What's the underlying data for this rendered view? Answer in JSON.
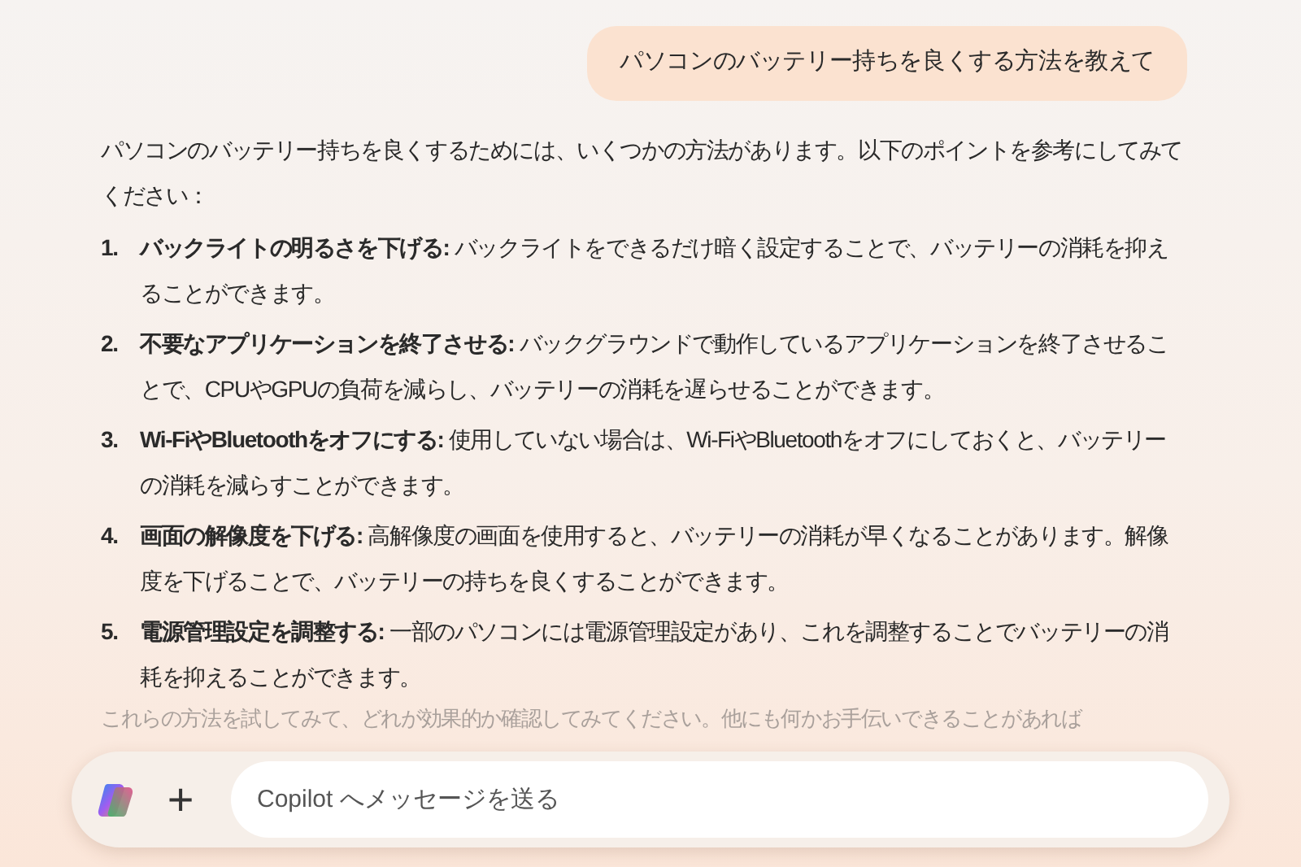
{
  "user_message": "パソコンのバッテリー持ちを良くする方法を教えて",
  "reply": {
    "intro": "パソコンのバッテリー持ちを良くするためには、いくつかの方法があります。以下のポイントを参考にしてみてください：",
    "items": [
      {
        "number": "1.",
        "text": "**バックライトの明るさを下げる:** バックライトをできるだけ暗く設定することで、バッテリーの消耗を抑えることができます。"
      },
      {
        "number": "2.",
        "text": "**不要なアプリケーションを終了させる:** バックグラウンドで動作しているアプリケーションを終了させることで、CPUやGPUの負荷を減らし、バッテリーの消耗を遅らせることができます。"
      },
      {
        "number": "3.",
        "text": "**Wi-FiやBluetoothをオフにする:** 使用していない場合は、Wi-FiやBluetoothをオフにしておくと、バッテリーの消耗を減らすことができます。"
      },
      {
        "number": "4.",
        "text": "**画面の解像度を下げる:** 高解像度の画面を使用すると、バッテリーの消耗が早くなることがあります。解像度を下げることで、バッテリーの持ちを良くすることができます。"
      },
      {
        "number": "5.",
        "text": "**電源管理設定を調整する:** 一部のパソコンには電源管理設定があり、これを調整することでバッテリーの消耗を抑えることができます。"
      }
    ],
    "outro": "これらの方法を試してみて、どれが効果的か確認してみてください。他にも何かお手伝いできることがあれば"
  },
  "composer": {
    "add_button": "+",
    "placeholder": "Copilot へメッセージを送る"
  }
}
